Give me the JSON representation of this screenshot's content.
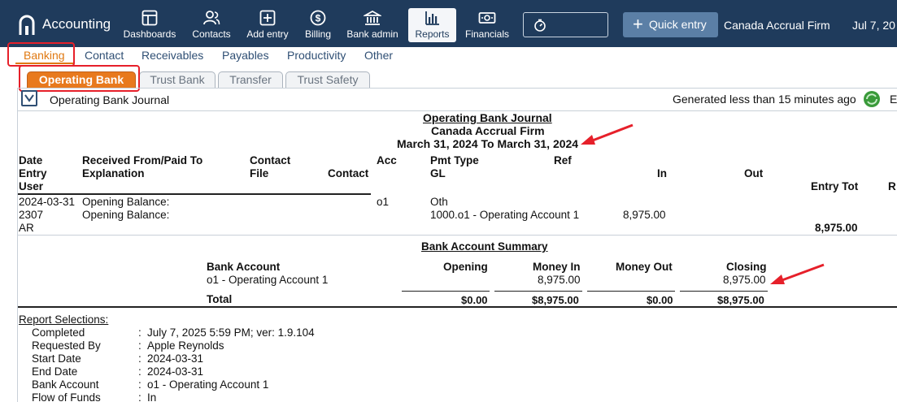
{
  "app": {
    "title": "Accounting",
    "firm": "Canada Accrual Firm",
    "date": "Jul 7, 20"
  },
  "nav": [
    {
      "label": "Dashboards",
      "icon": "dashboard-icon"
    },
    {
      "label": "Contacts",
      "icon": "contacts-icon"
    },
    {
      "label": "Add entry",
      "icon": "add-entry-icon"
    },
    {
      "label": "Billing",
      "icon": "billing-icon"
    },
    {
      "label": "Bank admin",
      "icon": "bank-icon"
    },
    {
      "label": "Reports",
      "icon": "reports-icon",
      "active": true
    },
    {
      "label": "Financials",
      "icon": "financials-icon"
    }
  ],
  "quick_entry": "Quick entry",
  "subnav": [
    "Banking",
    "Contact",
    "Receivables",
    "Payables",
    "Productivity",
    "Other"
  ],
  "tabs": [
    "Operating Bank",
    "Trust Bank",
    "Transfer",
    "Trust Safety"
  ],
  "report_bar": {
    "title": "Operating Bank Journal",
    "generated": "Generated less than 15 minutes ago",
    "cut": "E"
  },
  "report": {
    "title": "Operating Bank Journal",
    "firm": "Canada Accrual Firm",
    "range": "March 31, 2024 To March 31, 2024",
    "headers": {
      "date": "Date",
      "entry": "Entry",
      "user": "User",
      "received": "Received From/Paid To",
      "explanation": "Explanation",
      "contact_file": "Contact",
      "file": "File",
      "contact": "Contact",
      "acc": "Acc",
      "pmt_type": "Pmt Type",
      "gl": "GL",
      "ref": "Ref",
      "in": "In",
      "out": "Out",
      "entry_tot": "Entry Tot",
      "r": "R"
    },
    "row": {
      "date": "2024-03-31",
      "entry": "2307",
      "user": "AR",
      "received": "Opening Balance:",
      "explanation": "Opening Balance:",
      "acc": "o1",
      "pmt_type": "Oth",
      "gl": "1000.o1 - Operating Account 1",
      "in": "8,975.00",
      "entry_tot": "8,975.00"
    },
    "summary": {
      "title": "Bank Account Summary",
      "headers": {
        "account": "Bank Account",
        "opening": "Opening",
        "money_in": "Money In",
        "money_out": "Money Out",
        "closing": "Closing"
      },
      "row": {
        "account": "o1 - Operating Account 1",
        "money_in": "8,975.00",
        "closing": "8,975.00"
      },
      "total": {
        "label": "Total",
        "opening": "$0.00",
        "money_in": "$8,975.00",
        "money_out": "$0.00",
        "closing": "$8,975.00"
      }
    },
    "selections": {
      "title": "Report Selections:",
      "items": [
        {
          "label": "Completed",
          "value": "July 7, 2025 5:59 PM; ver: 1.9.104"
        },
        {
          "label": "Requested By",
          "value": "Apple Reynolds"
        },
        {
          "label": "Start Date",
          "value": "2024-03-31"
        },
        {
          "label": "End Date",
          "value": "2024-03-31"
        },
        {
          "label": "Bank Account",
          "value": "o1 - Operating Account 1"
        },
        {
          "label": "Flow of Funds",
          "value": "In"
        }
      ]
    }
  },
  "colors": {
    "topbar": "#1f3b5c",
    "accent": "#e8791d",
    "annotation": "#e6202a",
    "link": "#2f4f74"
  }
}
